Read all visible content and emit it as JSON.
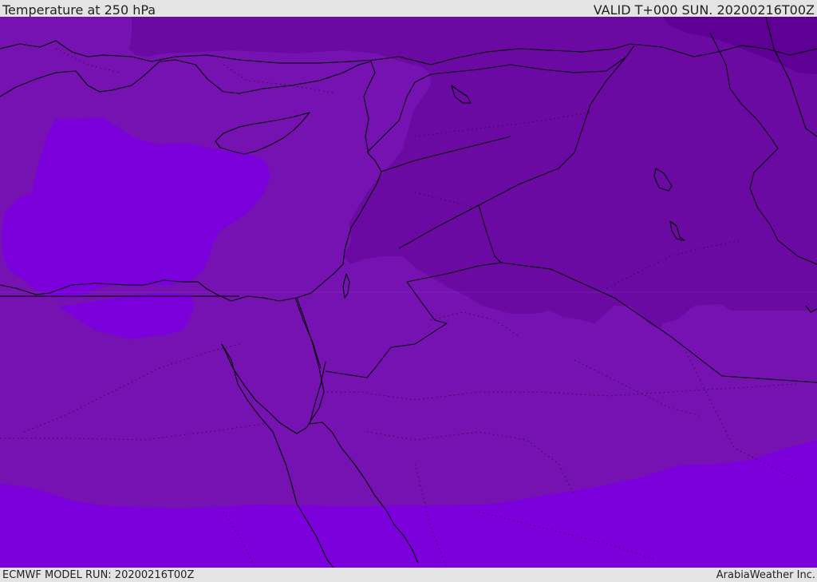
{
  "header": {
    "title": "Temperature at 250 hPa",
    "valid": "VALID T+000 SUN. 20200216T00Z"
  },
  "footer": {
    "model_run": "ECMWF MODEL RUN: 20200216T00Z",
    "credit": "ArabiaWeather Inc."
  },
  "map": {
    "colors": {
      "warm_band": "#7c00dc",
      "mid_band": "#7612b2",
      "cool_band": "#6a0aa2",
      "cold_band": "#5e0094",
      "coastline": "#000000"
    }
  }
}
